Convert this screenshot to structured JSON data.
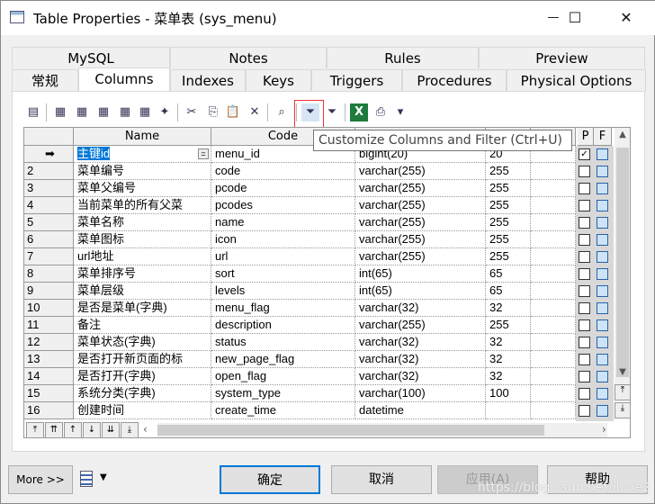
{
  "window": {
    "title": "Table Properties - 菜单表 (sys_menu)",
    "minimize": "—",
    "maximize": "☐",
    "close": "✕"
  },
  "tabs_row1": [
    "MySQL",
    "Notes",
    "Rules",
    "Preview"
  ],
  "tabs_row2": [
    "常规",
    "Columns",
    "Indexes",
    "Keys",
    "Triggers",
    "Procedures",
    "Physical Options"
  ],
  "active_tab": "Columns",
  "toolbar": {
    "icons": [
      "properties-icon",
      "insert-row-icon",
      "add-row-icon",
      "add-columns-icon",
      "reuse-columns-icon",
      "new-domain-icon",
      "wizard-icon",
      "cut-icon",
      "copy-icon",
      "paste-icon",
      "delete-icon",
      "find-icon",
      "customize-filter-icon",
      "enable-filter-icon",
      "excel-icon",
      "print-icon",
      "dropdown-icon"
    ],
    "tooltip": "Customize Columns and Filter (Ctrl+U)"
  },
  "grid": {
    "headers": {
      "name": "Name",
      "code": "Code",
      "datatype": "",
      "length": "",
      "precision": "",
      "p": "P",
      "f": "F"
    },
    "rows": [
      {
        "num": "➡",
        "name": "主键id",
        "code": "menu_id",
        "type": "bigint(20)",
        "len": "20",
        "p": true,
        "selected": true
      },
      {
        "num": "2",
        "name": "菜单编号",
        "code": "code",
        "type": "varchar(255)",
        "len": "255",
        "p": false
      },
      {
        "num": "3",
        "name": "菜单父编号",
        "code": "pcode",
        "type": "varchar(255)",
        "len": "255",
        "p": false
      },
      {
        "num": "4",
        "name": "当前菜单的所有父菜",
        "code": "pcodes",
        "type": "varchar(255)",
        "len": "255",
        "p": false
      },
      {
        "num": "5",
        "name": "菜单名称",
        "code": "name",
        "type": "varchar(255)",
        "len": "255",
        "p": false
      },
      {
        "num": "6",
        "name": "菜单图标",
        "code": "icon",
        "type": "varchar(255)",
        "len": "255",
        "p": false
      },
      {
        "num": "7",
        "name": "url地址",
        "code": "url",
        "type": "varchar(255)",
        "len": "255",
        "p": false
      },
      {
        "num": "8",
        "name": "菜单排序号",
        "code": "sort",
        "type": "int(65)",
        "len": "65",
        "p": false
      },
      {
        "num": "9",
        "name": "菜单层级",
        "code": "levels",
        "type": "int(65)",
        "len": "65",
        "p": false
      },
      {
        "num": "10",
        "name": "是否是菜单(字典)",
        "code": "menu_flag",
        "type": "varchar(32)",
        "len": "32",
        "p": false
      },
      {
        "num": "11",
        "name": "备注",
        "code": "description",
        "type": "varchar(255)",
        "len": "255",
        "p": false
      },
      {
        "num": "12",
        "name": "菜单状态(字典)",
        "code": "status",
        "type": "varchar(32)",
        "len": "32",
        "p": false
      },
      {
        "num": "13",
        "name": "是否打开新页面的标",
        "code": "new_page_flag",
        "type": "varchar(32)",
        "len": "32",
        "p": false
      },
      {
        "num": "14",
        "name": "是否打开(字典)",
        "code": "open_flag",
        "type": "varchar(32)",
        "len": "32",
        "p": false
      },
      {
        "num": "15",
        "name": "系统分类(字典)",
        "code": "system_type",
        "type": "varchar(100)",
        "len": "100",
        "p": false
      },
      {
        "num": "16",
        "name": "创建时间",
        "code": "create_time",
        "type": "datetime",
        "len": "",
        "p": false
      }
    ]
  },
  "nav_buttons": [
    "⤒",
    "⇈",
    "↑",
    "↓",
    "⇊",
    "⤓"
  ],
  "buttons": {
    "more": "More >>",
    "ok": "确定",
    "cancel": "取消",
    "apply": "应用(A)",
    "help": "帮助"
  },
  "watermark": "https://blog.csdn.net/ilove2"
}
